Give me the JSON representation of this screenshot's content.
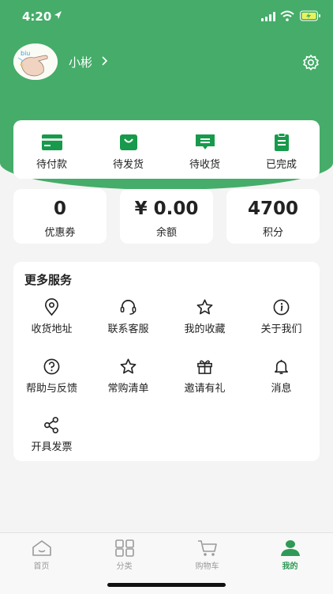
{
  "status_bar": {
    "time": "4:20"
  },
  "profile": {
    "username": "小彬",
    "avatar_text": "biu"
  },
  "orders": [
    {
      "label": "待付款",
      "icon": "card-icon"
    },
    {
      "label": "待发货",
      "icon": "shopping-bag-icon"
    },
    {
      "label": "待收货",
      "icon": "message-box-icon"
    },
    {
      "label": "已完成",
      "icon": "clipboard-icon"
    }
  ],
  "stats": [
    {
      "value": "0",
      "label": "优惠券"
    },
    {
      "value": "¥ 0.00",
      "label": "余额"
    },
    {
      "value": "4700",
      "label": "积分"
    }
  ],
  "services": {
    "title": "更多服务",
    "items": [
      {
        "label": "收货地址",
        "icon": "location-pin-icon"
      },
      {
        "label": "联系客服",
        "icon": "headset-icon"
      },
      {
        "label": "我的收藏",
        "icon": "star-icon"
      },
      {
        "label": "关于我们",
        "icon": "info-icon"
      },
      {
        "label": "帮助与反馈",
        "icon": "question-icon"
      },
      {
        "label": "常购清单",
        "icon": "star-outline-icon"
      },
      {
        "label": "邀请有礼",
        "icon": "gift-icon"
      },
      {
        "label": "消息",
        "icon": "bell-icon"
      },
      {
        "label": "开具发票",
        "icon": "share-icon"
      }
    ]
  },
  "tabs": [
    {
      "label": "首页",
      "icon": "home-icon",
      "active": false
    },
    {
      "label": "分类",
      "icon": "grid-icon",
      "active": false
    },
    {
      "label": "购物车",
      "icon": "cart-icon",
      "active": false
    },
    {
      "label": "我的",
      "icon": "user-icon",
      "active": true
    }
  ],
  "colors": {
    "brand": "#45ad69",
    "active_tab": "#2f9a55",
    "inactive": "#9a9a9a",
    "background": "#f4f4f4"
  }
}
